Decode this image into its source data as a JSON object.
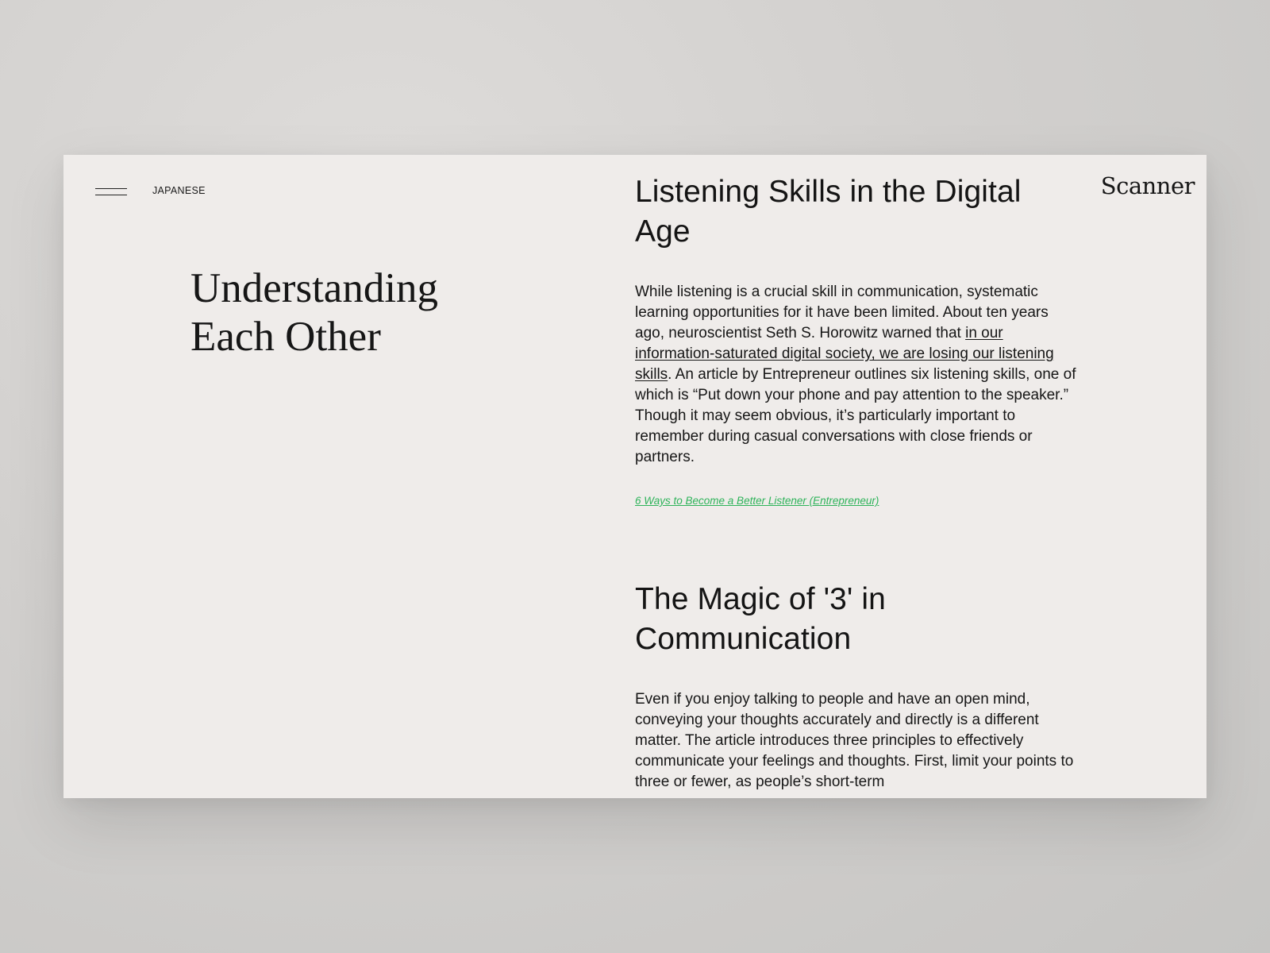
{
  "nav": {
    "menu_icon": "hamburger-menu-icon",
    "language_label": "JAPANESE"
  },
  "logo": "Scanner",
  "page_title_line1": "Understanding",
  "page_title_line2": "Each Other",
  "sections": [
    {
      "heading": "Listening Skills in the Digital Age",
      "body_before_link": "While listening is a crucial skill in communication, systematic learning opportunities for it have been limited. About ten years ago, neuroscientist Seth S. Horowitz warned that ",
      "inline_link": "in our information-saturated digital society, we are losing our listening skills",
      "body_after_link": ". An article by Entrepreneur outlines six listening skills, one of which is “Put down your phone and pay attention to the speaker.” Though it may seem obvious, it’s particularly important to remember during casual conversations with close friends or partners.",
      "source_link": " 6 Ways to Become a Better Listener (Entrepreneur)"
    },
    {
      "heading": "The Magic of '3' in Communication",
      "body": "Even if you enjoy talking to people and have an open mind, conveying your thoughts accurately and directly is a different matter. The article introduces three principles to effectively communicate your feelings and thoughts. First, limit your points to three or fewer, as people’s short-term"
    }
  ],
  "colors": {
    "page_background": "#efecea",
    "backdrop": "#d2d0ce",
    "text": "#161616",
    "source_link": "#2eb35a"
  }
}
